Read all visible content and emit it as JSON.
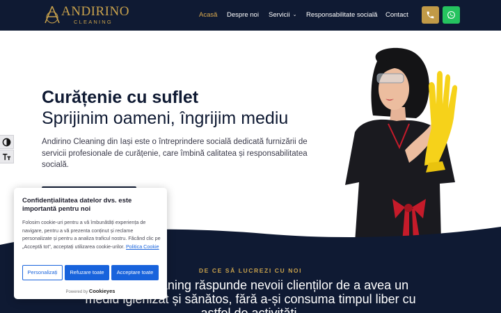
{
  "header": {
    "logo_name": "ANDIRINO",
    "logo_sub": "CLEANING",
    "nav": [
      {
        "label": "Acasă"
      },
      {
        "label": "Despre noi"
      },
      {
        "label": "Servicii"
      },
      {
        "label": "Responsabilitate socială"
      },
      {
        "label": "Contact"
      }
    ],
    "phone_icon": "phone-icon",
    "whatsapp_icon": "whatsapp-icon"
  },
  "hero": {
    "title": "Curățenie cu suflet",
    "subtitle": "Sprijinim oameni, îngrijim mediu",
    "text": "Andirino Cleaning din Iași este o întreprindere socială dedicată furnizării de servicii profesionale de curățenie, care îmbină calitatea și responsabilitatea socială."
  },
  "why": {
    "label": "DE CE SĂ LUCREZI CU NOI",
    "text": "Andirino Cleaning răspunde nevoii clienților de a avea un mediu igienizat și sănătos, fără a-și consuma timpul liber cu astfel de activități."
  },
  "cookie": {
    "title": "Confidențialitatea datelor dvs. este importantă pentru noi",
    "body": "Folosim cookie-uri pentru a vă îmbunătăți experiența de navigare, pentru a vă prezenta conținut și reclame personalizate și pentru a analiza traficul nostru. Făcând clic pe „Acceptă tot”, acceptați utilizarea cookie-urilor.",
    "link": "Politica Cookie",
    "btn_customize": "Personalizați",
    "btn_reject": "Refuzare toate",
    "btn_accept": "Acceptare toate",
    "powered_by": "Powered by",
    "brand": "Cookieyes"
  },
  "colors": {
    "navy": "#0f1a33",
    "gold": "#c9a24c",
    "whatsapp": "#25c35f",
    "cookie_blue": "#1863dc"
  }
}
